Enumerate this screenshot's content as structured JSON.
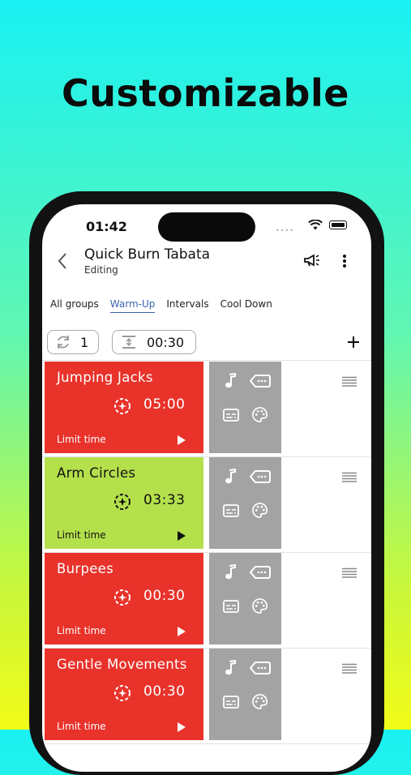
{
  "headline": "Customizable",
  "status": {
    "time": "01:42"
  },
  "header": {
    "title": "Quick Burn Tabata",
    "subtitle": "Editing"
  },
  "tabs": [
    {
      "label": "All groups",
      "active": false
    },
    {
      "label": "Warm-Up",
      "active": true
    },
    {
      "label": "Intervals",
      "active": false
    },
    {
      "label": "Cool Down",
      "active": false
    }
  ],
  "controls": {
    "repeat_count": "1",
    "rest_time": "00:30"
  },
  "exercises": [
    {
      "name": "Jumping Jacks",
      "time": "05:00",
      "limit_label": "Limit time",
      "color": "#e8322a",
      "text_color": "#ffffff"
    },
    {
      "name": "Arm Circles",
      "time": "03:33",
      "limit_label": "Limit time",
      "color": "#b4e04c",
      "text_color": "#111111"
    },
    {
      "name": "Burpees",
      "time": "00:30",
      "limit_label": "Limit time",
      "color": "#e8322a",
      "text_color": "#ffffff"
    },
    {
      "name": "Gentle Movements",
      "time": "00:30",
      "limit_label": "Limit time",
      "color": "#e8322a",
      "text_color": "#ffffff"
    }
  ],
  "icons": {
    "back": "chevron-left-icon",
    "announce": "megaphone-icon",
    "more": "more-vertical-icon",
    "repeat": "repeat-icon",
    "rest": "rest-interval-icon",
    "add": "plus-icon",
    "music": "music-note-icon",
    "tag": "label-icon",
    "subtitles": "subtitles-icon",
    "palette": "palette-icon",
    "timer": "timer-icon",
    "play": "play-icon",
    "drag": "drag-handle-icon"
  }
}
